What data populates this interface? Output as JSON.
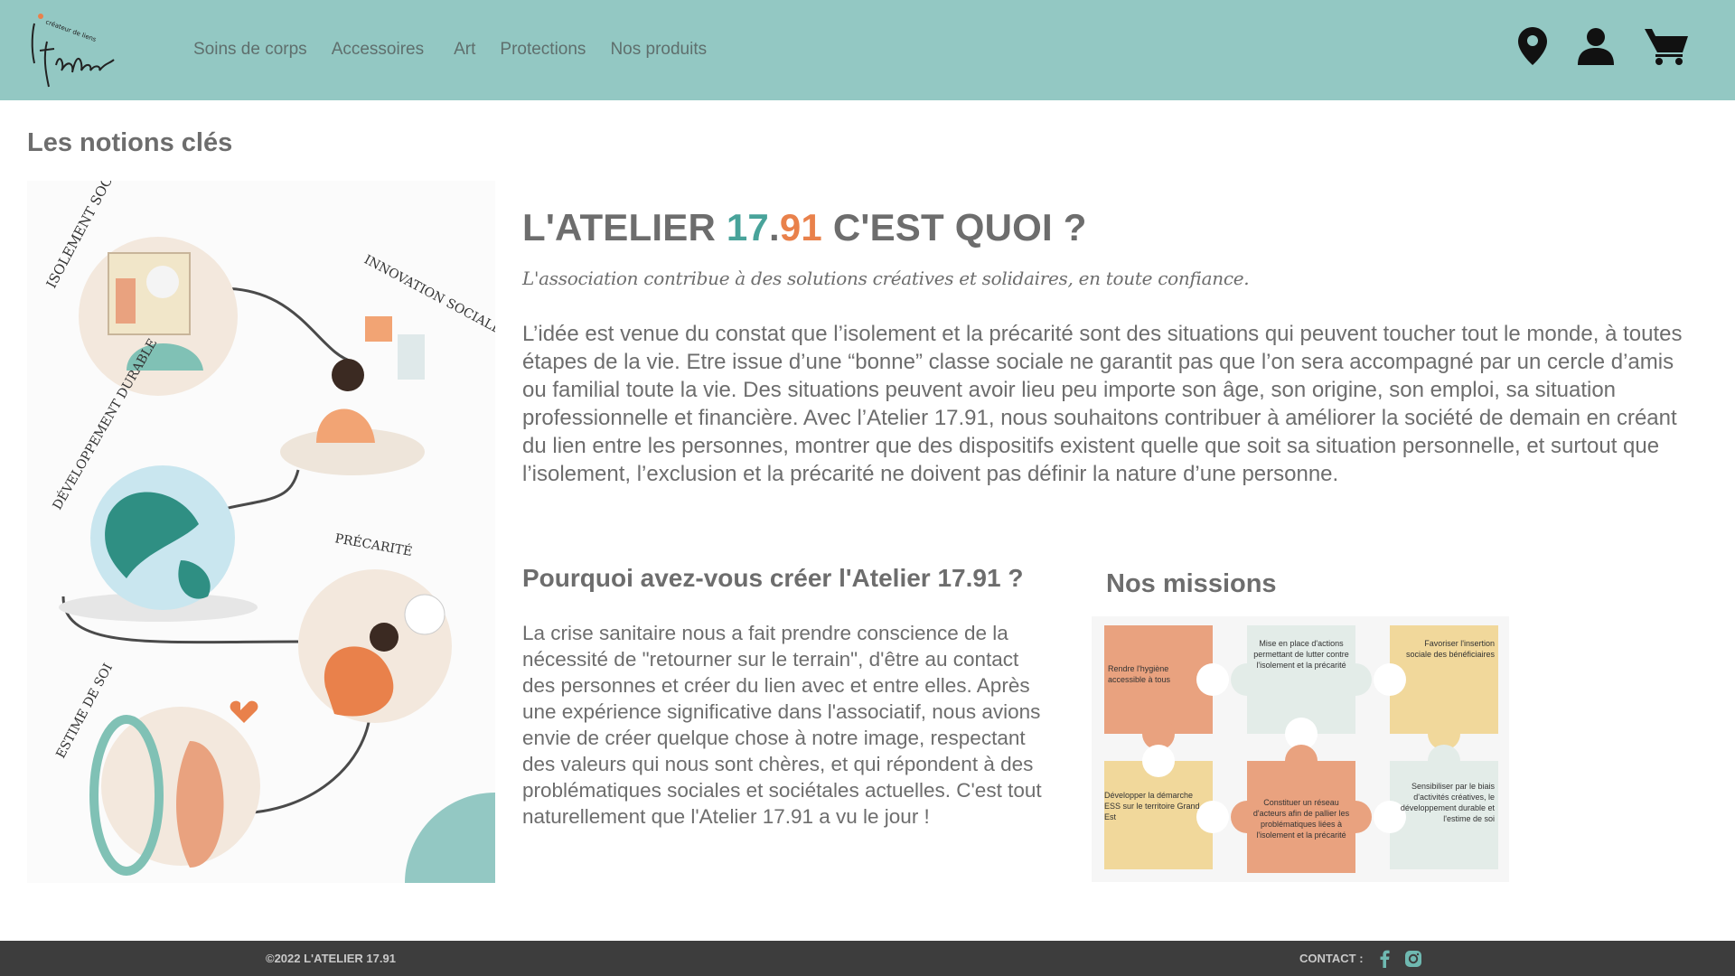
{
  "header": {
    "logo_text": "l'Atelier",
    "logo_tagline": "créateur de liens",
    "nav": [
      {
        "label": "Soins de corps"
      },
      {
        "label": "Accessoires"
      },
      {
        "label": "Art"
      },
      {
        "label": "Protections"
      },
      {
        "label": "Nos produits"
      }
    ],
    "icons": [
      "location-pin-icon",
      "user-icon",
      "cart-icon"
    ],
    "background": "#93c8c3"
  },
  "page": {
    "section_label": "Les notions clés",
    "title_prefix": "L'ATELIER ",
    "title_num1": "17",
    "title_dot": ".",
    "title_num2": "91",
    "title_suffix": " C'EST QUOI ?",
    "tagline": "L'association contribue à des solutions créatives et solidaires, en toute confiance.",
    "intro": "L’idée est venue du constat que l’isolement et la précarité sont des situations qui peuvent toucher tout le monde, à toutes étapes de la vie. Etre issue d’une “bonne” classe sociale ne garantit pas que l’on sera accompagné par un cercle d’amis ou familial toute la vie. Des situations peuvent avoir lieu peu importe son âge, son origine, son emploi, sa situation professionnelle et financière. Avec l’Atelier 17.91, nous souhaitons contribuer à améliorer la société de demain en créant du lien entre les personnes, montrer que des dispositifs existent quelle que soit sa situation personnelle, et surtout que l’isolement, l’exclusion et la précarité ne doivent pas définir la nature d’une personne.",
    "why_title": "Pourquoi avez-vous créer l'Atelier 17.91 ?",
    "why_text": "La crise sanitaire nous a fait prendre conscience de la nécessité de \"retourner sur le terrain\", d'être au contact des personnes et créer du lien avec et entre elles. Après une expérience significative dans l'associatif, nous avions envie de créer quelque chose à notre image, respectant des valeurs qui nous sont chères, et qui répondent à des problématiques sociales et sociétales actuelles. C'est tout naturellement que l'Atelier 17.91 a vu le jour !",
    "missions_title": "Nos missions",
    "accent_teal": "#48a39a",
    "accent_orange": "#e9814b"
  },
  "illustration": {
    "labels": [
      "ISOLEMENT SOCIAL",
      "INNOVATION SOCIALE",
      "DÉVELOPPEMENT DURABLE",
      "PRÉCARITÉ",
      "ESTIME DE SOI"
    ]
  },
  "missions": [
    {
      "text": "Rendre l'hygiène accessible à tous",
      "color": "#e9a27f"
    },
    {
      "text": "Mise en place d'actions permettant de lutter contre l'isolement et la précarité",
      "color": "#e3ece8"
    },
    {
      "text": "Favoriser l'insertion sociale des bénéficiaires",
      "color": "#f1d89b"
    },
    {
      "text": "Développer la démarche ESS sur le territoire Grand Est",
      "color": "#f1d89b"
    },
    {
      "text": "Constituer un réseau d'acteurs afin de pallier les problématiques liées à l'isolement et la précarité",
      "color": "#e9a27f"
    },
    {
      "text": "Sensibiliser par le biais d'activités créatives, le développement durable et l'estime de soi",
      "color": "#e3ece8"
    }
  ],
  "footer": {
    "copyright": "©2022 L'ATELIER 17.91",
    "contact": "CONTACT :",
    "icons": [
      "facebook-icon",
      "instagram-icon"
    ]
  }
}
